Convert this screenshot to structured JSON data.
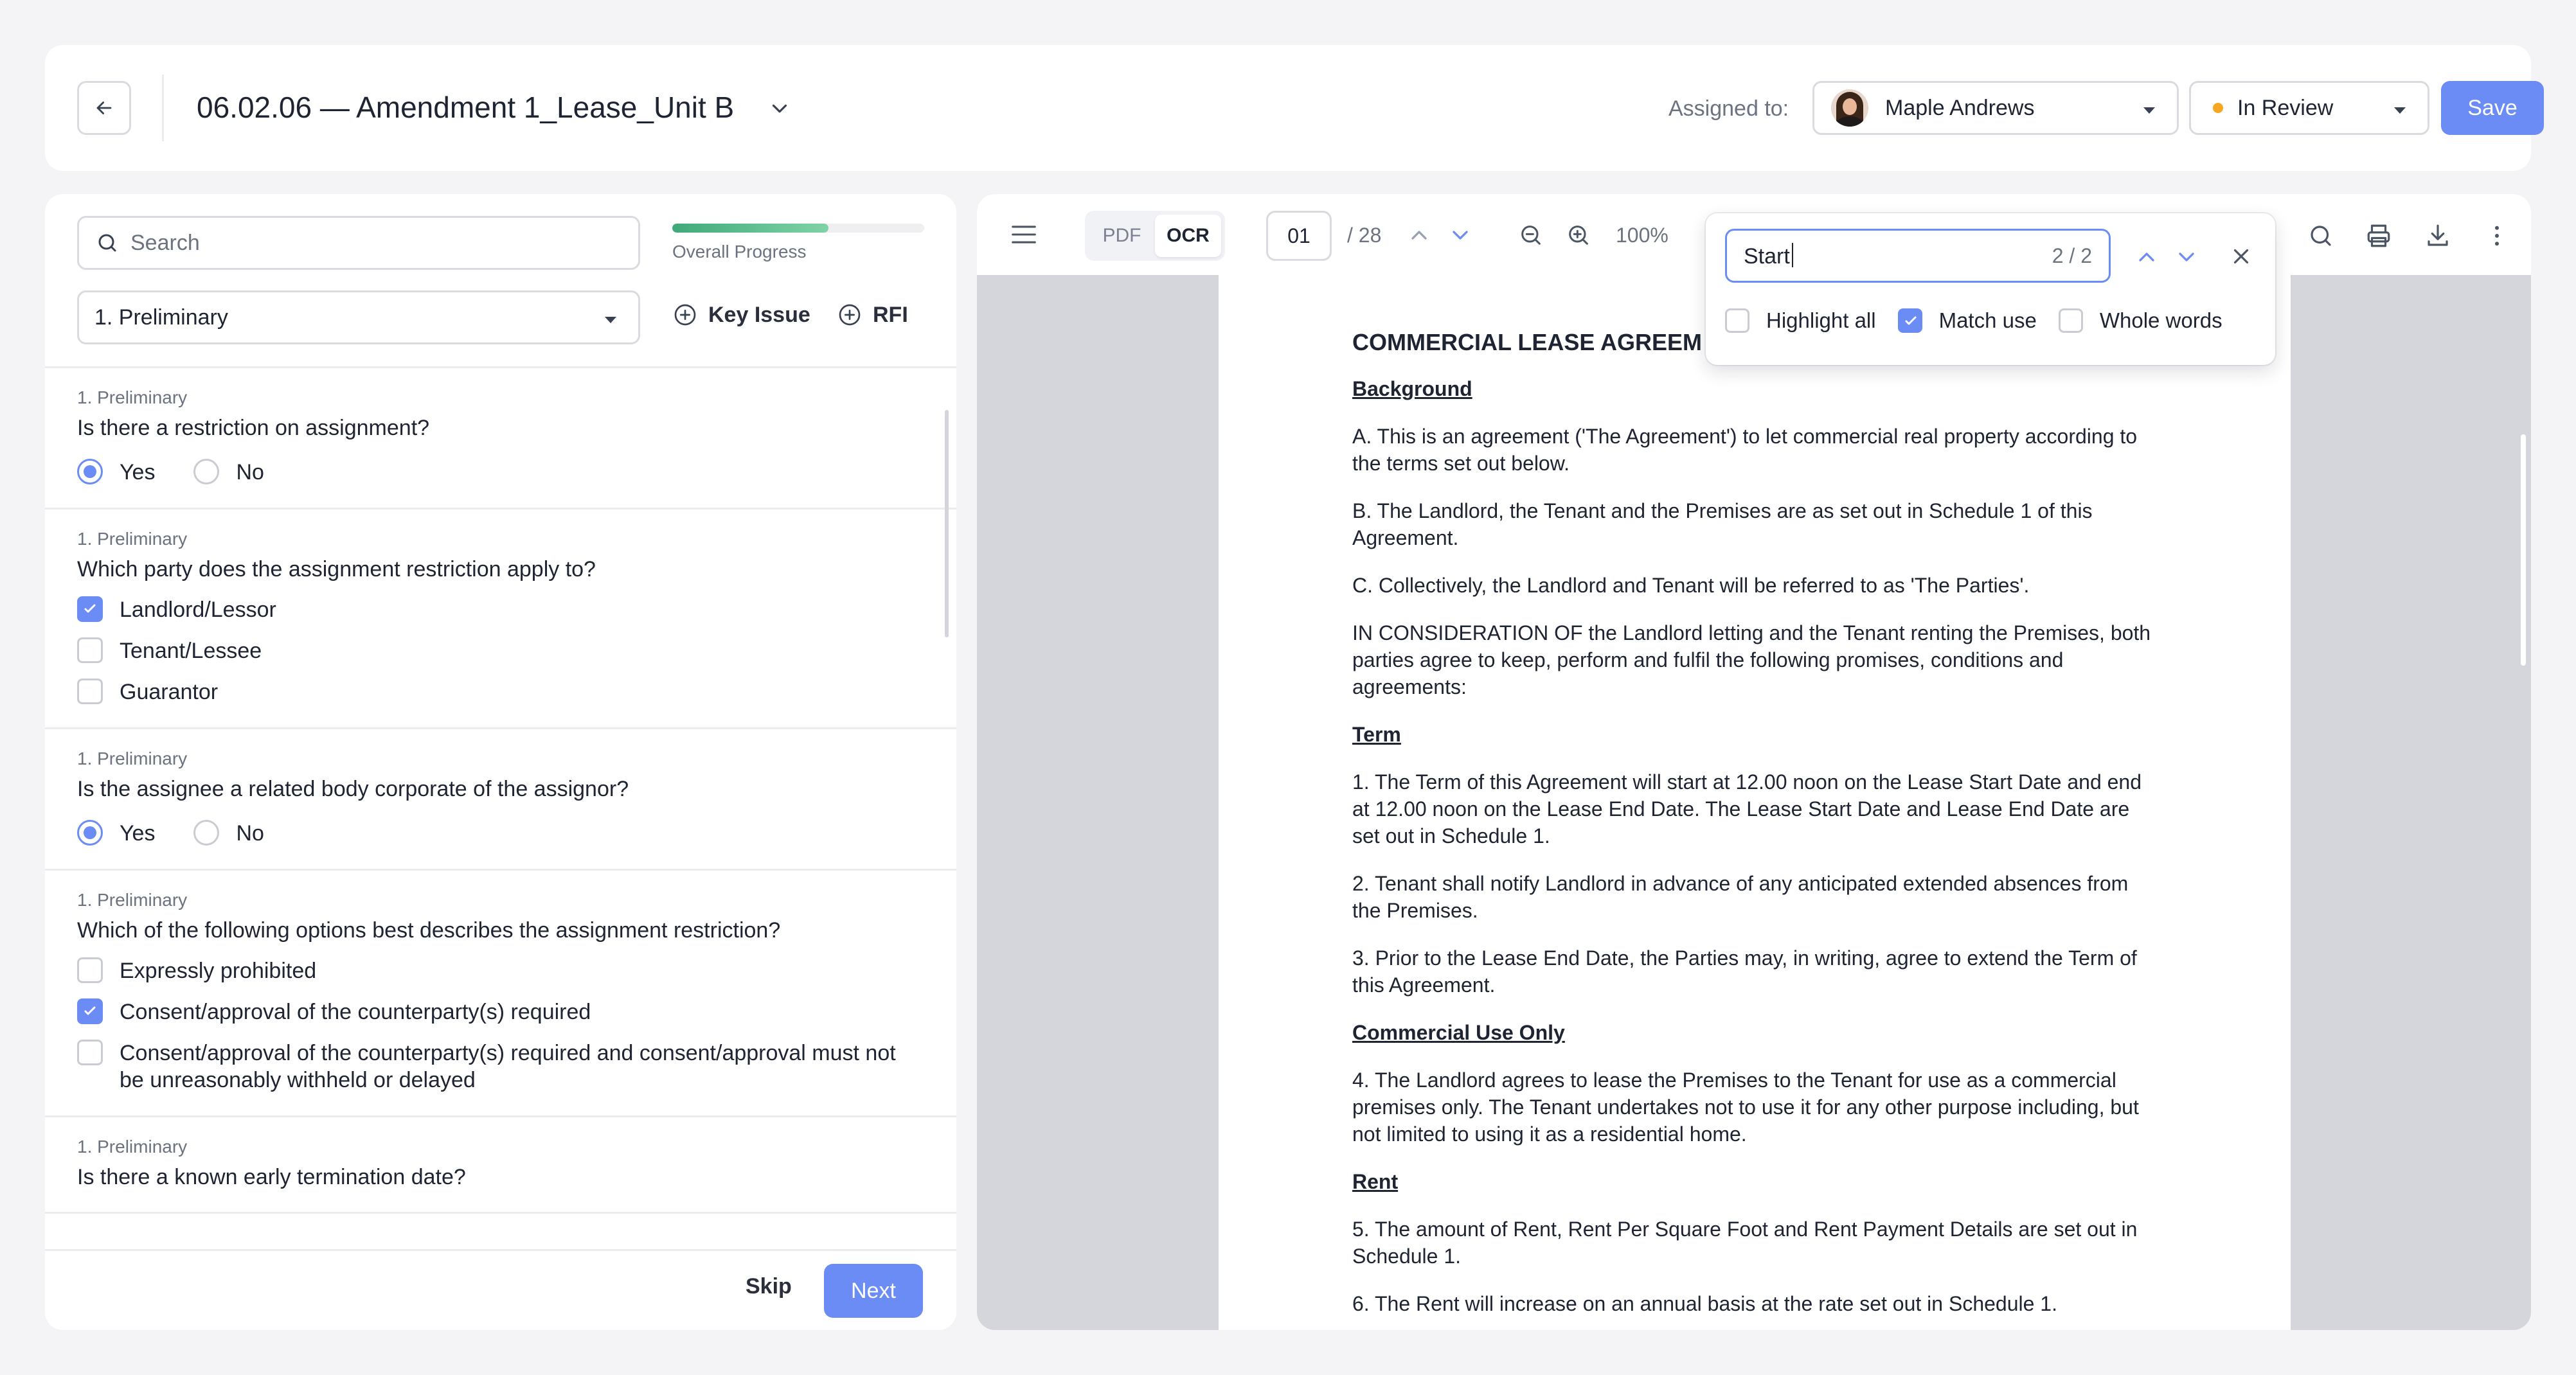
{
  "header": {
    "title": "06.02.06 — Amendment 1_Lease_Unit B",
    "assigned_label": "Assigned to:",
    "assignee": "Maple Andrews",
    "status": "In Review",
    "status_color": "#f5a623",
    "save_label": "Save"
  },
  "left": {
    "search_placeholder": "Search",
    "progress_label": "Overall Progress",
    "progress_fraction": 0.62,
    "section_selected": "1. Preliminary",
    "key_issue_label": "Key Issue",
    "rfi_label": "RFI",
    "questions": [
      {
        "section": "1. Preliminary",
        "text": "Is there a restriction on assignment?",
        "type": "radio",
        "options": [
          {
            "label": "Yes",
            "checked": true
          },
          {
            "label": "No",
            "checked": false
          }
        ]
      },
      {
        "section": "1. Preliminary",
        "text": "Which party does the assignment restriction apply to?",
        "type": "checkbox",
        "options": [
          {
            "label": "Landlord/Lessor",
            "checked": true
          },
          {
            "label": "Tenant/Lessee",
            "checked": false
          },
          {
            "label": "Guarantor",
            "checked": false
          }
        ]
      },
      {
        "section": "1. Preliminary",
        "text": "Is the assignee a related body corporate of the assignor?",
        "type": "radio",
        "options": [
          {
            "label": "Yes",
            "checked": true
          },
          {
            "label": "No",
            "checked": false
          }
        ]
      },
      {
        "section": "1. Preliminary",
        "text": "Which of the following options best describes the assignment restriction?",
        "type": "checkbox",
        "options": [
          {
            "label": "Expressly prohibited",
            "checked": false
          },
          {
            "label": "Consent/approval of the counterparty(s) required",
            "checked": true
          },
          {
            "label": "Consent/approval of the counterparty(s) required and consent/approval must not be unreasonably withheld or delayed",
            "checked": false
          }
        ]
      },
      {
        "section": "1. Preliminary",
        "text": "Is there a known early termination date?",
        "type": "none",
        "options": []
      }
    ],
    "skip_label": "Skip",
    "next_label": "Next"
  },
  "viewer": {
    "mode_pdf": "PDF",
    "mode_ocr": "OCR",
    "active_mode": "OCR",
    "page_current": "01",
    "page_total": "/ 28",
    "zoom": "100%",
    "find": {
      "value": "Start",
      "count": "2 / 2",
      "highlight_all": "Highlight all",
      "highlight_all_checked": false,
      "match_case": "Match use",
      "match_case_checked": true,
      "whole_words": "Whole words",
      "whole_words_checked": false
    },
    "doc": {
      "title": "COMMERCIAL LEASE AGREEM",
      "blocks": [
        {
          "type": "heading",
          "text": "Background"
        },
        {
          "type": "para",
          "text": "A. This is an agreement ('The Agreement') to let commercial real property according to the terms set out below."
        },
        {
          "type": "para",
          "text": "B. The Landlord, the Tenant and the Premises are as set out in Schedule 1 of this Agreement."
        },
        {
          "type": "para",
          "text": "C. Collectively, the Landlord and Tenant will be referred to as 'The Parties'."
        },
        {
          "type": "para",
          "text": "IN CONSIDERATION OF the Landlord letting and the Tenant renting the Premises, both parties agree to keep, perform and fulfil the following promises, conditions and agreements:"
        },
        {
          "type": "heading",
          "text": "Term"
        },
        {
          "type": "para",
          "text": "1. The Term of this Agreement will start at 12.00 noon on the Lease Start Date and end at 12.00 noon on the Lease End Date. The Lease Start Date and Lease End Date are set out in Schedule 1."
        },
        {
          "type": "para",
          "text": "2. Tenant shall notify Landlord in advance of any anticipated extended absences from the Premises."
        },
        {
          "type": "para",
          "text": "3. Prior to the Lease End Date, the Parties may, in writing, agree to extend the Term of this Agreement."
        },
        {
          "type": "heading",
          "text": "Commercial Use Only"
        },
        {
          "type": "para",
          "text": "4. The Landlord agrees to lease the Premises to the Tenant for use as a commercial premises only. The Tenant undertakes not to use it for any other purpose including, but not limited to using it as a residential home."
        },
        {
          "type": "heading",
          "text": "Rent"
        },
        {
          "type": "para",
          "text": "5. The amount of Rent, Rent Per Square Foot and Rent Payment Details are set out in Schedule 1."
        },
        {
          "type": "para",
          "text": "6. The Rent will increase on an annual basis at the rate set out in Schedule 1."
        }
      ]
    }
  }
}
